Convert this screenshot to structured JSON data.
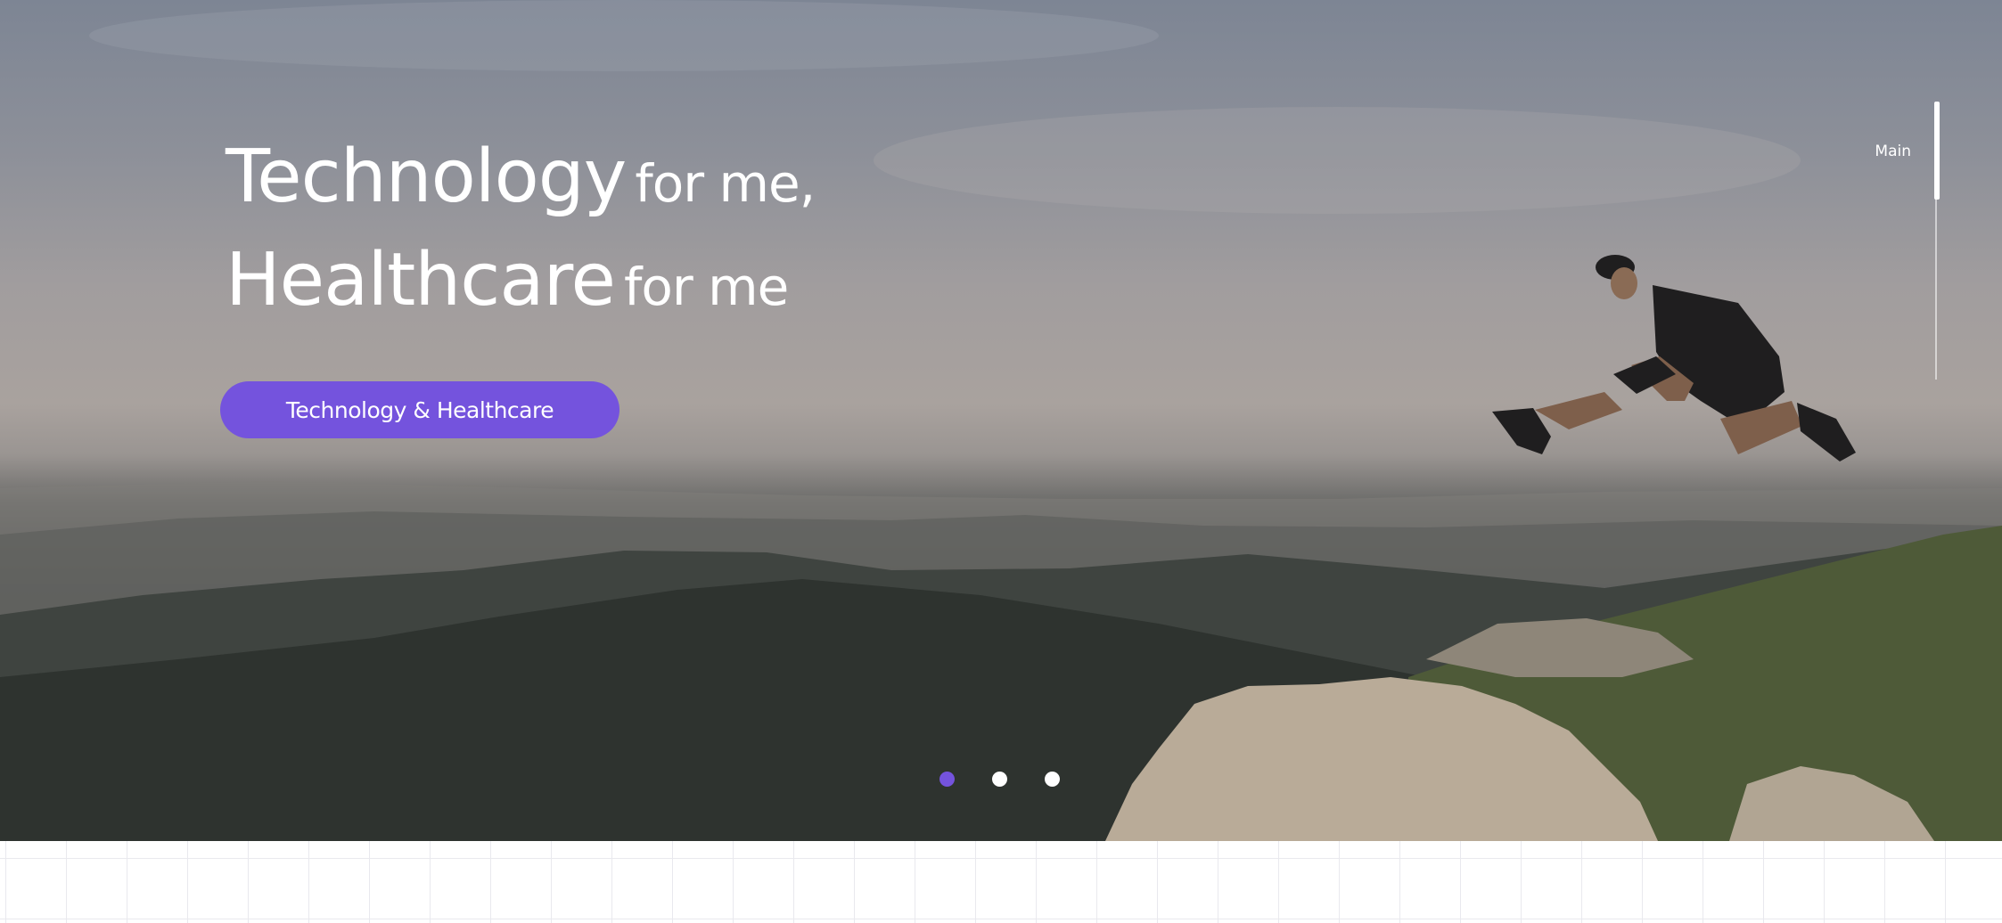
{
  "hero": {
    "headline": {
      "line1_big": "Technology",
      "line1_small": "for me,",
      "line2_big": "Healthcare",
      "line2_small": "for me"
    },
    "cta_label": "Technology & Healthcare",
    "accent_color": "#7453dd"
  },
  "side_nav": {
    "label": "Main"
  },
  "slider": {
    "total_slides": 3,
    "active_slide": 1
  }
}
